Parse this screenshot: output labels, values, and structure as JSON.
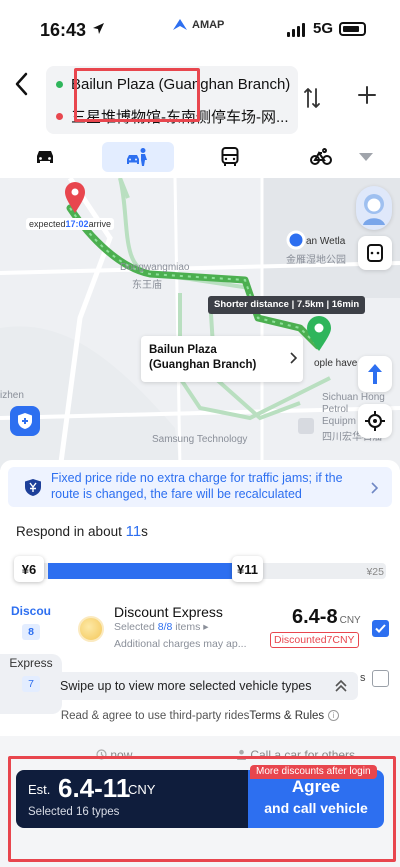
{
  "status_bar": {
    "time": "16:43",
    "network": "5G",
    "app_logo": "AMAP"
  },
  "route": {
    "origin": "Bailun Plaza (Guanghan Branch)",
    "destination": "三星堆博物馆-东南侧停车场-网...",
    "origin_color": "#2fb55b",
    "destination_color": "#e8464e"
  },
  "modes": [
    {
      "name": "car",
      "active": false
    },
    {
      "name": "ride-hailing",
      "active": true
    },
    {
      "name": "bus",
      "active": false
    },
    {
      "name": "bike",
      "active": false
    }
  ],
  "map": {
    "start_tag_prefix": "expected",
    "start_tag_time": "17:02",
    "start_tag_suffix": "arrive",
    "distance_tag": "Shorter distance | 7.5km | 16min",
    "destination_card": "Bailun Plaza (Guanghan Branch)",
    "labels": {
      "wetland_en": "an Wetla",
      "wetland_cn": "金雁湿地公园",
      "dongwang_en": "Dongwangmiao",
      "dongwang_cn": "东王庙",
      "zhen": "izhen",
      "samsung": "Samsung Technology",
      "people": "ople have u",
      "sichuan_1": "Sichuan Hong",
      "sichuan_2": "Petrol",
      "sichuan_3": "Equipm",
      "sichuan_4": "四川宏华石油"
    }
  },
  "notice": {
    "text": "Fixed price ride no extra charge for traffic jams; if the route is changed, the fare will be recalculated"
  },
  "respond": {
    "prefix": "Respond in about ",
    "seconds": "11",
    "suffix": "s"
  },
  "price_slider": {
    "min_label": "¥6",
    "current_label": "¥11",
    "max_label": "¥25",
    "min": 6,
    "max": 25,
    "value": 11
  },
  "vehicle_tabs": [
    {
      "label": "Discou",
      "count": "8",
      "active": true
    },
    {
      "label": "Express",
      "count": "7",
      "active": false
    }
  ],
  "vehicle": {
    "title": "Discount Express",
    "selected_prefix": "Selected ",
    "selected_count": "8/8",
    "selected_suffix": " items ▸",
    "extra": "Additional charges may ap...",
    "price": "6.4-8",
    "currency": "CNY",
    "discount": "Discounted7CNY",
    "checked": true
  },
  "second_row_fragment": "s",
  "swipe_tip": "Swipe up to view more selected vehicle types",
  "terms": {
    "prefix": "Read & agree to use third-party rides",
    "link": "Terms & Rules"
  },
  "call_options": {
    "left": "now",
    "right": "Call a car for others"
  },
  "cta": {
    "est": "Est.",
    "price": "6.4-11",
    "currency": "CNY",
    "selected": "Selected 16 types",
    "button_line1": "Agree",
    "button_line2": "and call vehicle",
    "login_badge": "More discounts after login"
  },
  "colors": {
    "accent": "#2d6ff0",
    "dark": "#0f1d3c",
    "alert": "#e8464e",
    "route": "#4caf50"
  }
}
